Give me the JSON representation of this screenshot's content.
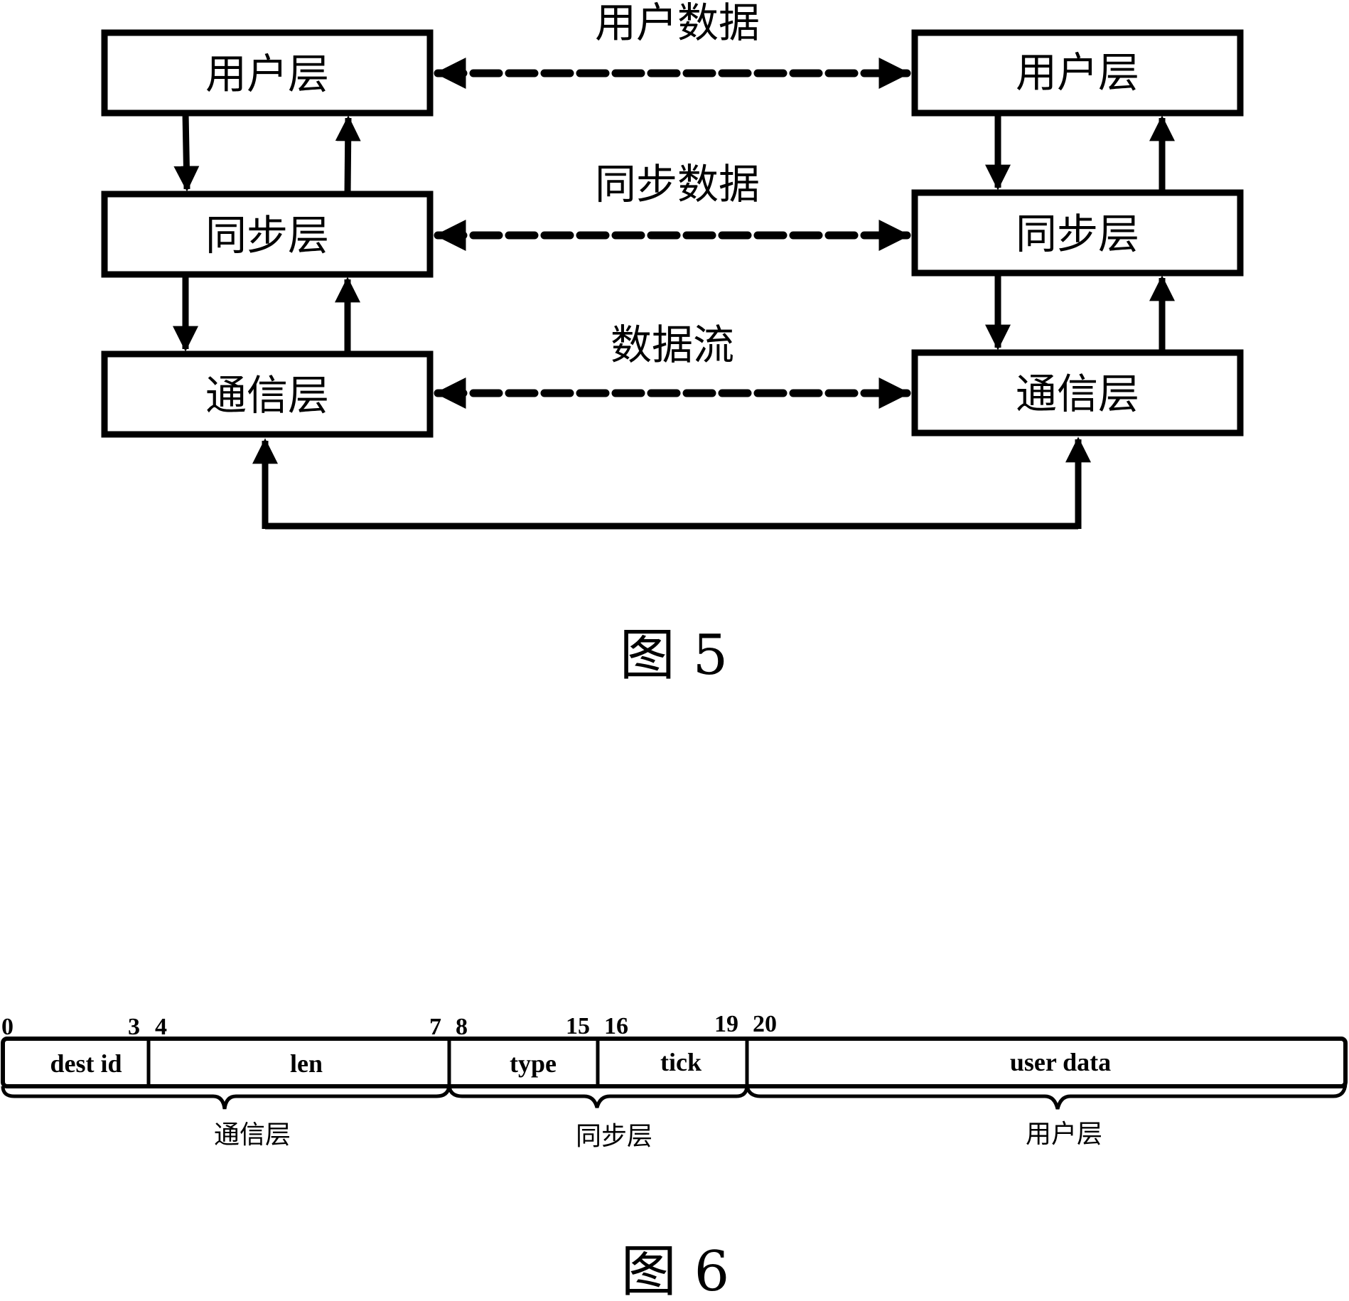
{
  "figure5": {
    "caption": "图 5",
    "left_stack": [
      {
        "label": "用户层"
      },
      {
        "label": "同步层"
      },
      {
        "label": "通信层"
      }
    ],
    "right_stack": [
      {
        "label": "用户层"
      },
      {
        "label": "同步层"
      },
      {
        "label": "通信层"
      }
    ],
    "peer_links": [
      {
        "label": "用户数据"
      },
      {
        "label": "同步数据"
      },
      {
        "label": "数据流"
      }
    ]
  },
  "figure6": {
    "caption": "图 6",
    "fields": [
      {
        "label": "dest id",
        "start_bit": "0",
        "end_bit": "3"
      },
      {
        "label": "len",
        "start_bit": "4",
        "end_bit": "7"
      },
      {
        "label": "type",
        "start_bit": "8",
        "end_bit": "15"
      },
      {
        "label": "tick",
        "start_bit": "16",
        "end_bit": "19"
      },
      {
        "label": "user data",
        "start_bit": "20",
        "end_bit": ""
      }
    ],
    "groups": [
      {
        "label": "通信层"
      },
      {
        "label": "同步层"
      },
      {
        "label": "用户层"
      }
    ]
  }
}
